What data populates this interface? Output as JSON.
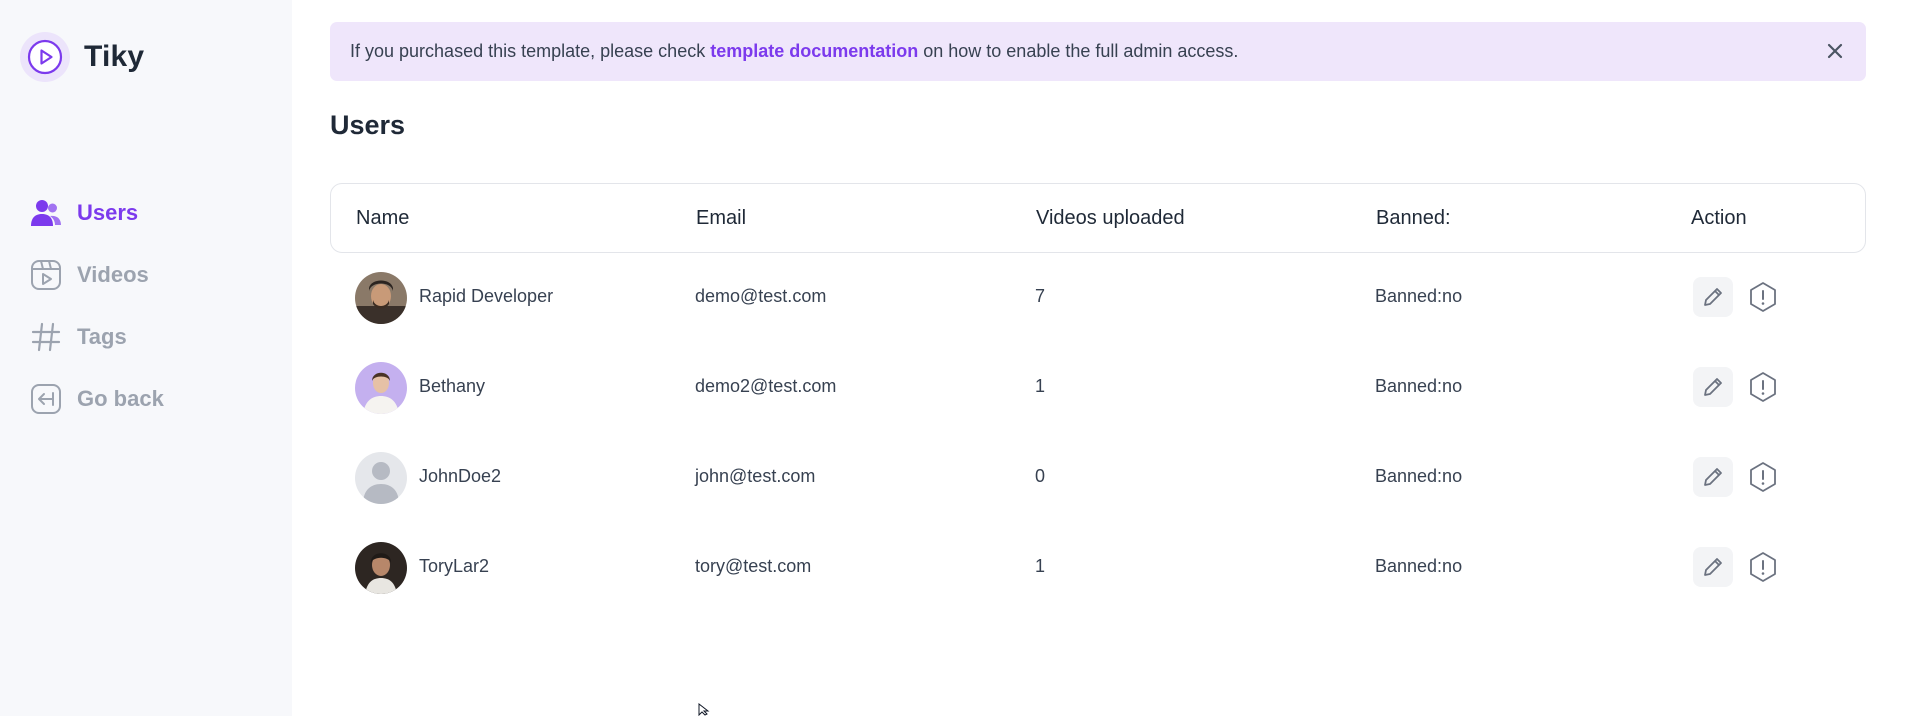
{
  "app": {
    "name": "Tiky"
  },
  "nav": {
    "items": [
      {
        "label": "Users",
        "icon": "users-icon",
        "active": true
      },
      {
        "label": "Videos",
        "icon": "video-icon",
        "active": false
      },
      {
        "label": "Tags",
        "icon": "hash-icon",
        "active": false
      },
      {
        "label": "Go back",
        "icon": "go-back-icon",
        "active": false
      }
    ]
  },
  "alert": {
    "prefix": "If you purchased this template, please check",
    "link": "template documentation",
    "suffix": "on how to enable the full admin access."
  },
  "page": {
    "title": "Users"
  },
  "table": {
    "headers": {
      "name": "Name",
      "email": "Email",
      "videos": "Videos uploaded",
      "banned": "Banned:",
      "action": "Action"
    },
    "rows": [
      {
        "name": "Rapid Developer",
        "email": "demo@test.com",
        "videos": "7",
        "banned": "Banned:no"
      },
      {
        "name": "Bethany",
        "email": "demo2@test.com",
        "videos": "1",
        "banned": "Banned:no"
      },
      {
        "name": "JohnDoe2",
        "email": "john@test.com",
        "videos": "0",
        "banned": "Banned:no"
      },
      {
        "name": "ToryLar2",
        "email": "tory@test.com",
        "videos": "1",
        "banned": "Banned:no"
      }
    ]
  },
  "colors": {
    "accent": "#7c3aed",
    "alert_bg": "#efe6fb",
    "sidebar_bg": "#f7f8fb",
    "muted": "#9ca3af"
  }
}
